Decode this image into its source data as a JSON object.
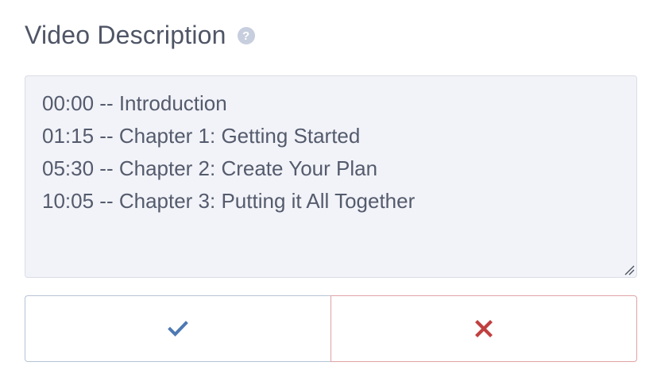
{
  "field": {
    "label": "Video Description",
    "help_icon": "question-circle-icon",
    "help_glyph": "?"
  },
  "textarea": {
    "value": "00:00 -- Introduction\n01:15 -- Chapter 1: Getting Started\n05:30 -- Chapter 2: Create Your Plan\n10:05 -- Chapter 3: Putting it All Together"
  },
  "actions": {
    "confirm_icon": "checkmark-icon",
    "cancel_icon": "close-icon",
    "confirm_color": "#4e79b3",
    "cancel_color": "#c0403f"
  }
}
